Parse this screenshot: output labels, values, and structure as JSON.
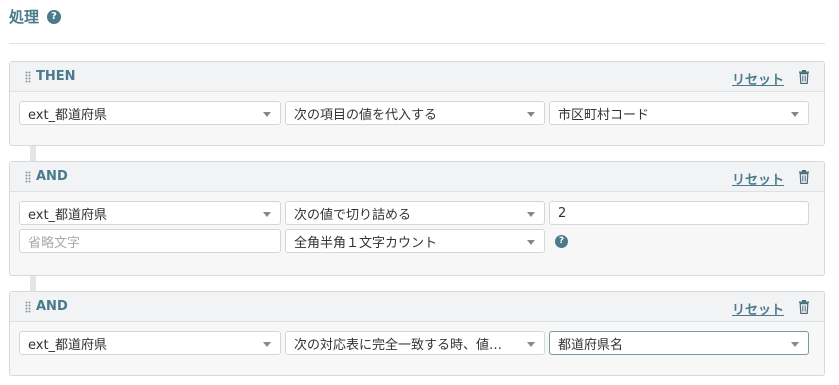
{
  "section": {
    "title": "処理",
    "help": "?"
  },
  "blocks": [
    {
      "title": "THEN",
      "reset": "リセット",
      "rows": [
        {
          "field": "ext_都道府県",
          "operation": "次の項目の値を代入する",
          "value": "市区町村コード"
        }
      ]
    },
    {
      "title": "AND",
      "reset": "リセット",
      "rows": [
        {
          "field": "ext_都道府県",
          "operation": "次の値で切り詰める",
          "value": "2"
        },
        {
          "field_placeholder": "省略文字",
          "operation": "全角半角１文字カウント",
          "help": "?"
        }
      ]
    },
    {
      "title": "AND",
      "reset": "リセット",
      "rows": [
        {
          "field": "ext_都道府県",
          "operation": "次の対応表に完全一致する時、値…",
          "value": "都道府県名"
        }
      ]
    }
  ]
}
